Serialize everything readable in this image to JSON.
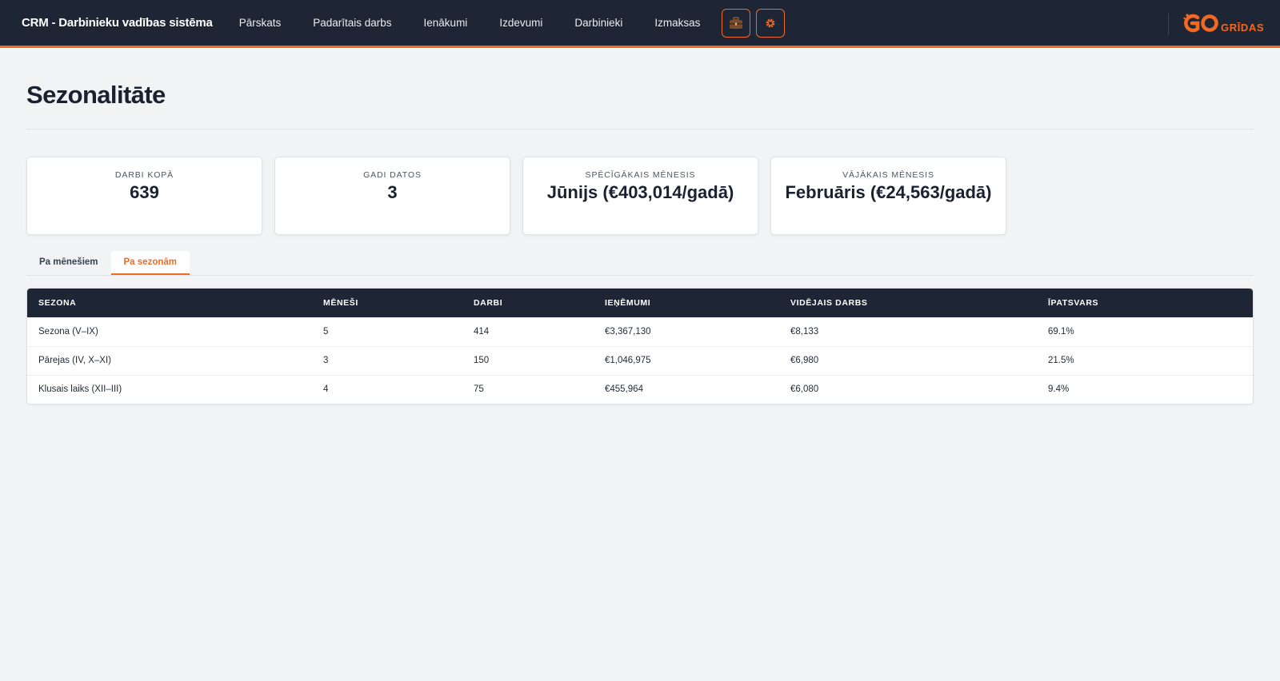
{
  "app": {
    "title": "CRM - Darbinieku vadības sistēma",
    "logo_text": "GRĪDAS",
    "logo_mark": "GO"
  },
  "nav": {
    "items": [
      "Pārskats",
      "Padarītais darbs",
      "Ienākumi",
      "Izdevumi",
      "Darbinieki",
      "Izmaksas"
    ],
    "icon_buttons": [
      {
        "icon": "briefcase-icon"
      },
      {
        "icon": "gear-icon"
      }
    ]
  },
  "colors": {
    "accent": "#f26a21",
    "navy": "#1e2636",
    "background": "#f2f3f5"
  },
  "page": {
    "title": "Sezonalitāte"
  },
  "stats": [
    {
      "label": "DARBI KOPĀ",
      "value": "639"
    },
    {
      "label": "GADI DATOS",
      "value": "3"
    },
    {
      "label": "SPĒCĪGĀKAIS MĒNESIS",
      "value": "Jūnijs (€403,014/gadā)"
    },
    {
      "label": "VĀJĀKAIS MĒNESIS",
      "value": "Februāris (€24,563/gadā)"
    }
  ],
  "tabs": [
    {
      "label": "Pa mēnešiem",
      "active": false
    },
    {
      "label": "Pa sezonām",
      "active": true
    }
  ],
  "table": {
    "columns": [
      "SEZONA",
      "MĒNEŠI",
      "DARBI",
      "IEŅĒMUMI",
      "VIDĒJAIS DARBS",
      "ĪPATSVARS"
    ],
    "rows": [
      [
        "Sezona (V–IX)",
        "5",
        "414",
        "€3,367,130",
        "€8,133",
        "69.1%"
      ],
      [
        "Pārejas (IV, X–XI)",
        "3",
        "150",
        "€1,046,975",
        "€6,980",
        "21.5%"
      ],
      [
        "Klusais laiks (XII–III)",
        "4",
        "75",
        "€455,964",
        "€6,080",
        "9.4%"
      ]
    ]
  }
}
